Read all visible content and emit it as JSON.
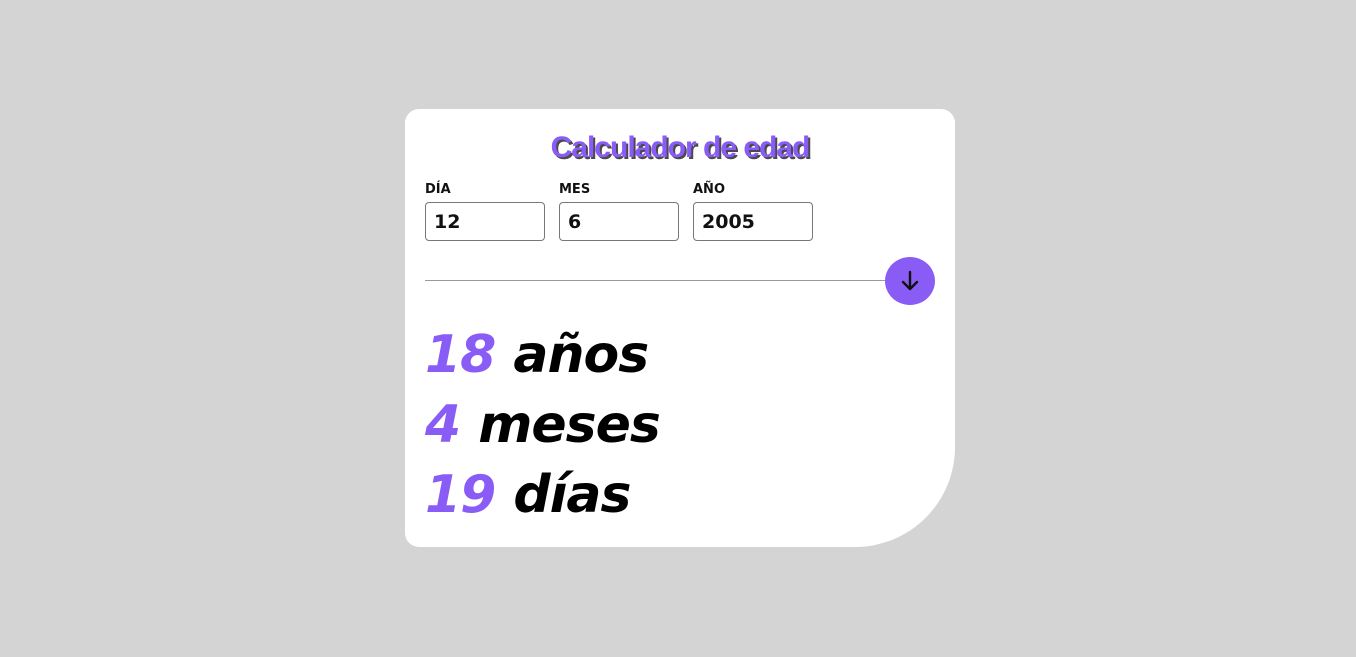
{
  "app": {
    "title": "Calculador de edad"
  },
  "form": {
    "day": {
      "label": "DÍA",
      "value": "12"
    },
    "month": {
      "label": "MES",
      "value": "6"
    },
    "year": {
      "label": "AÑO",
      "value": "2005"
    },
    "submit_icon": "arrow-down-icon"
  },
  "result": {
    "years": {
      "value": "18",
      "unit": "años"
    },
    "months": {
      "value": "4",
      "unit": "meses"
    },
    "days": {
      "value": "19",
      "unit": "días"
    }
  },
  "colors": {
    "accent": "#8a5cf6",
    "background": "#d4d4d4",
    "card": "#ffffff",
    "text": "#000000"
  }
}
